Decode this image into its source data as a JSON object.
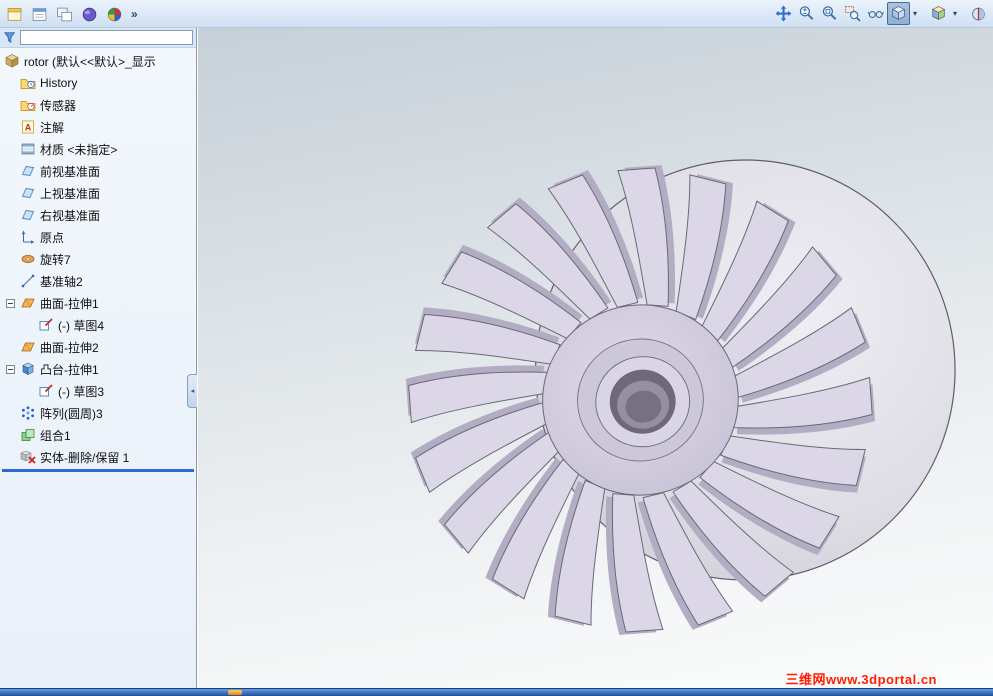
{
  "toolbar_left": {
    "overflow_chevron": "»",
    "buttons": [
      {
        "icon": "template-icon"
      },
      {
        "icon": "form-icon"
      },
      {
        "icon": "windows-icon"
      },
      {
        "icon": "sphere-icon"
      },
      {
        "icon": "resources-ball-icon"
      }
    ]
  },
  "tree_filter": {
    "value": "",
    "icon": "filter-funnel-icon"
  },
  "feature_tree": {
    "root_label": "rotor (默认<<默认>_显示",
    "items": [
      {
        "label": "History",
        "icon": "history-folder-icon"
      },
      {
        "label": "传感器",
        "icon": "sensors-folder-icon"
      },
      {
        "label": "注解",
        "icon": "annotations-icon"
      },
      {
        "label": "材质 <未指定>",
        "icon": "material-icon"
      },
      {
        "label": "前视基准面",
        "icon": "plane-icon"
      },
      {
        "label": "上视基准面",
        "icon": "plane-icon"
      },
      {
        "label": "右视基准面",
        "icon": "plane-icon"
      },
      {
        "label": "原点",
        "icon": "origin-icon"
      },
      {
        "label": "旋转7",
        "icon": "revolve-feature-icon"
      },
      {
        "label": "基准轴2",
        "icon": "axis-icon"
      },
      {
        "label": "曲面-拉伸1",
        "icon": "surface-extrude-icon",
        "expanded": true
      },
      {
        "label": "(-) 草图4",
        "icon": "sketch-icon",
        "child": true
      },
      {
        "label": "曲面-拉伸2",
        "icon": "surface-extrude-icon"
      },
      {
        "label": "凸台-拉伸1",
        "icon": "boss-extrude-icon",
        "expanded": true
      },
      {
        "label": "(-) 草图3",
        "icon": "sketch-icon",
        "child": true
      },
      {
        "label": "阵列(圆周)3",
        "icon": "circular-pattern-icon"
      },
      {
        "label": "组合1",
        "icon": "combine-icon"
      },
      {
        "label": "实体-删除/保留 1",
        "icon": "body-delete-icon",
        "selected": true
      }
    ]
  },
  "view_toolbar": {
    "dropdown_glyph": "▾",
    "buttons": [
      {
        "icon": "pan-icon"
      },
      {
        "icon": "zoom-in-out-icon"
      },
      {
        "icon": "zoom-fit-icon"
      },
      {
        "icon": "zoom-area-icon"
      },
      {
        "icon": "previous-view-icon"
      },
      {
        "icon": "view-orientation-icon",
        "active": true
      },
      {
        "icon": "display-style-icon"
      },
      {
        "icon": "section-view-icon"
      }
    ]
  },
  "tree_splitter_glyph": "◂",
  "watermark": {
    "text": "三维网www.3dportal.cn"
  },
  "colors": {
    "selection_bar": "#2a6ad4",
    "watermark": "#ff1e00",
    "model_fill": "#dcd7e6",
    "drum_fill": "#dddce4"
  }
}
